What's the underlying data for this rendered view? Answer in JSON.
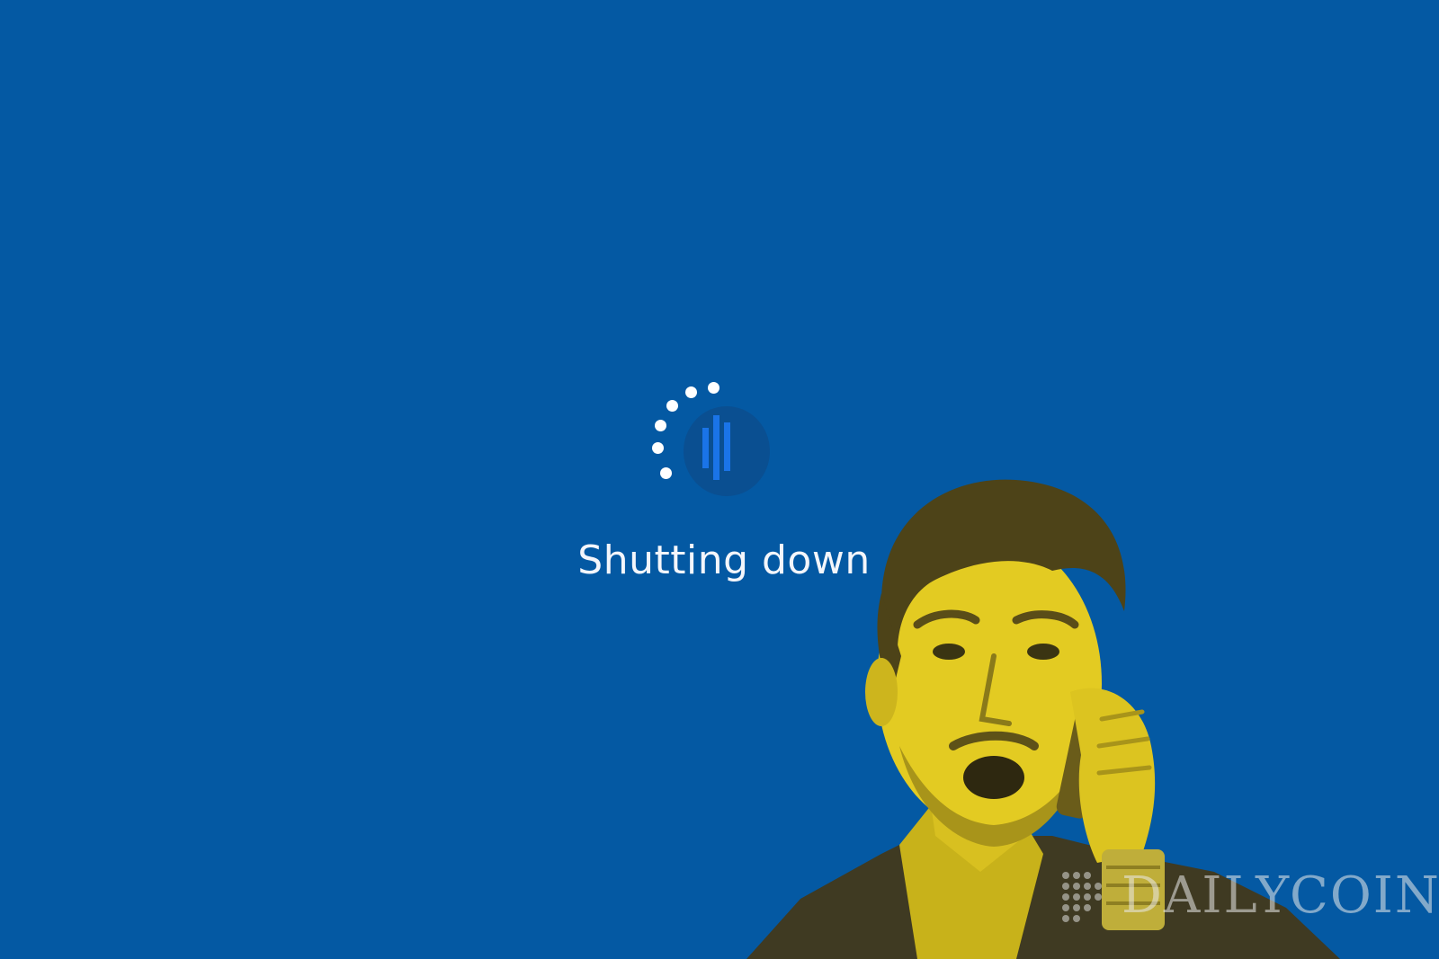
{
  "status": {
    "message": "Shutting down"
  },
  "spinner": {
    "icon": "loading-spinner-icon",
    "dot_color": "#ffffff"
  },
  "logo": {
    "icon": "audio-bars-icon",
    "bar_color": "#1a74e8",
    "badge_color": "#0a4f91"
  },
  "watermark": {
    "text": "DAILYCOIN",
    "icon": "dotted-logo-icon"
  },
  "colors": {
    "background": "#0459a3",
    "text": "#f4f6fb",
    "photo_tint": "#e0c81e"
  },
  "photo": {
    "subject": "man-on-phone-surprised"
  }
}
